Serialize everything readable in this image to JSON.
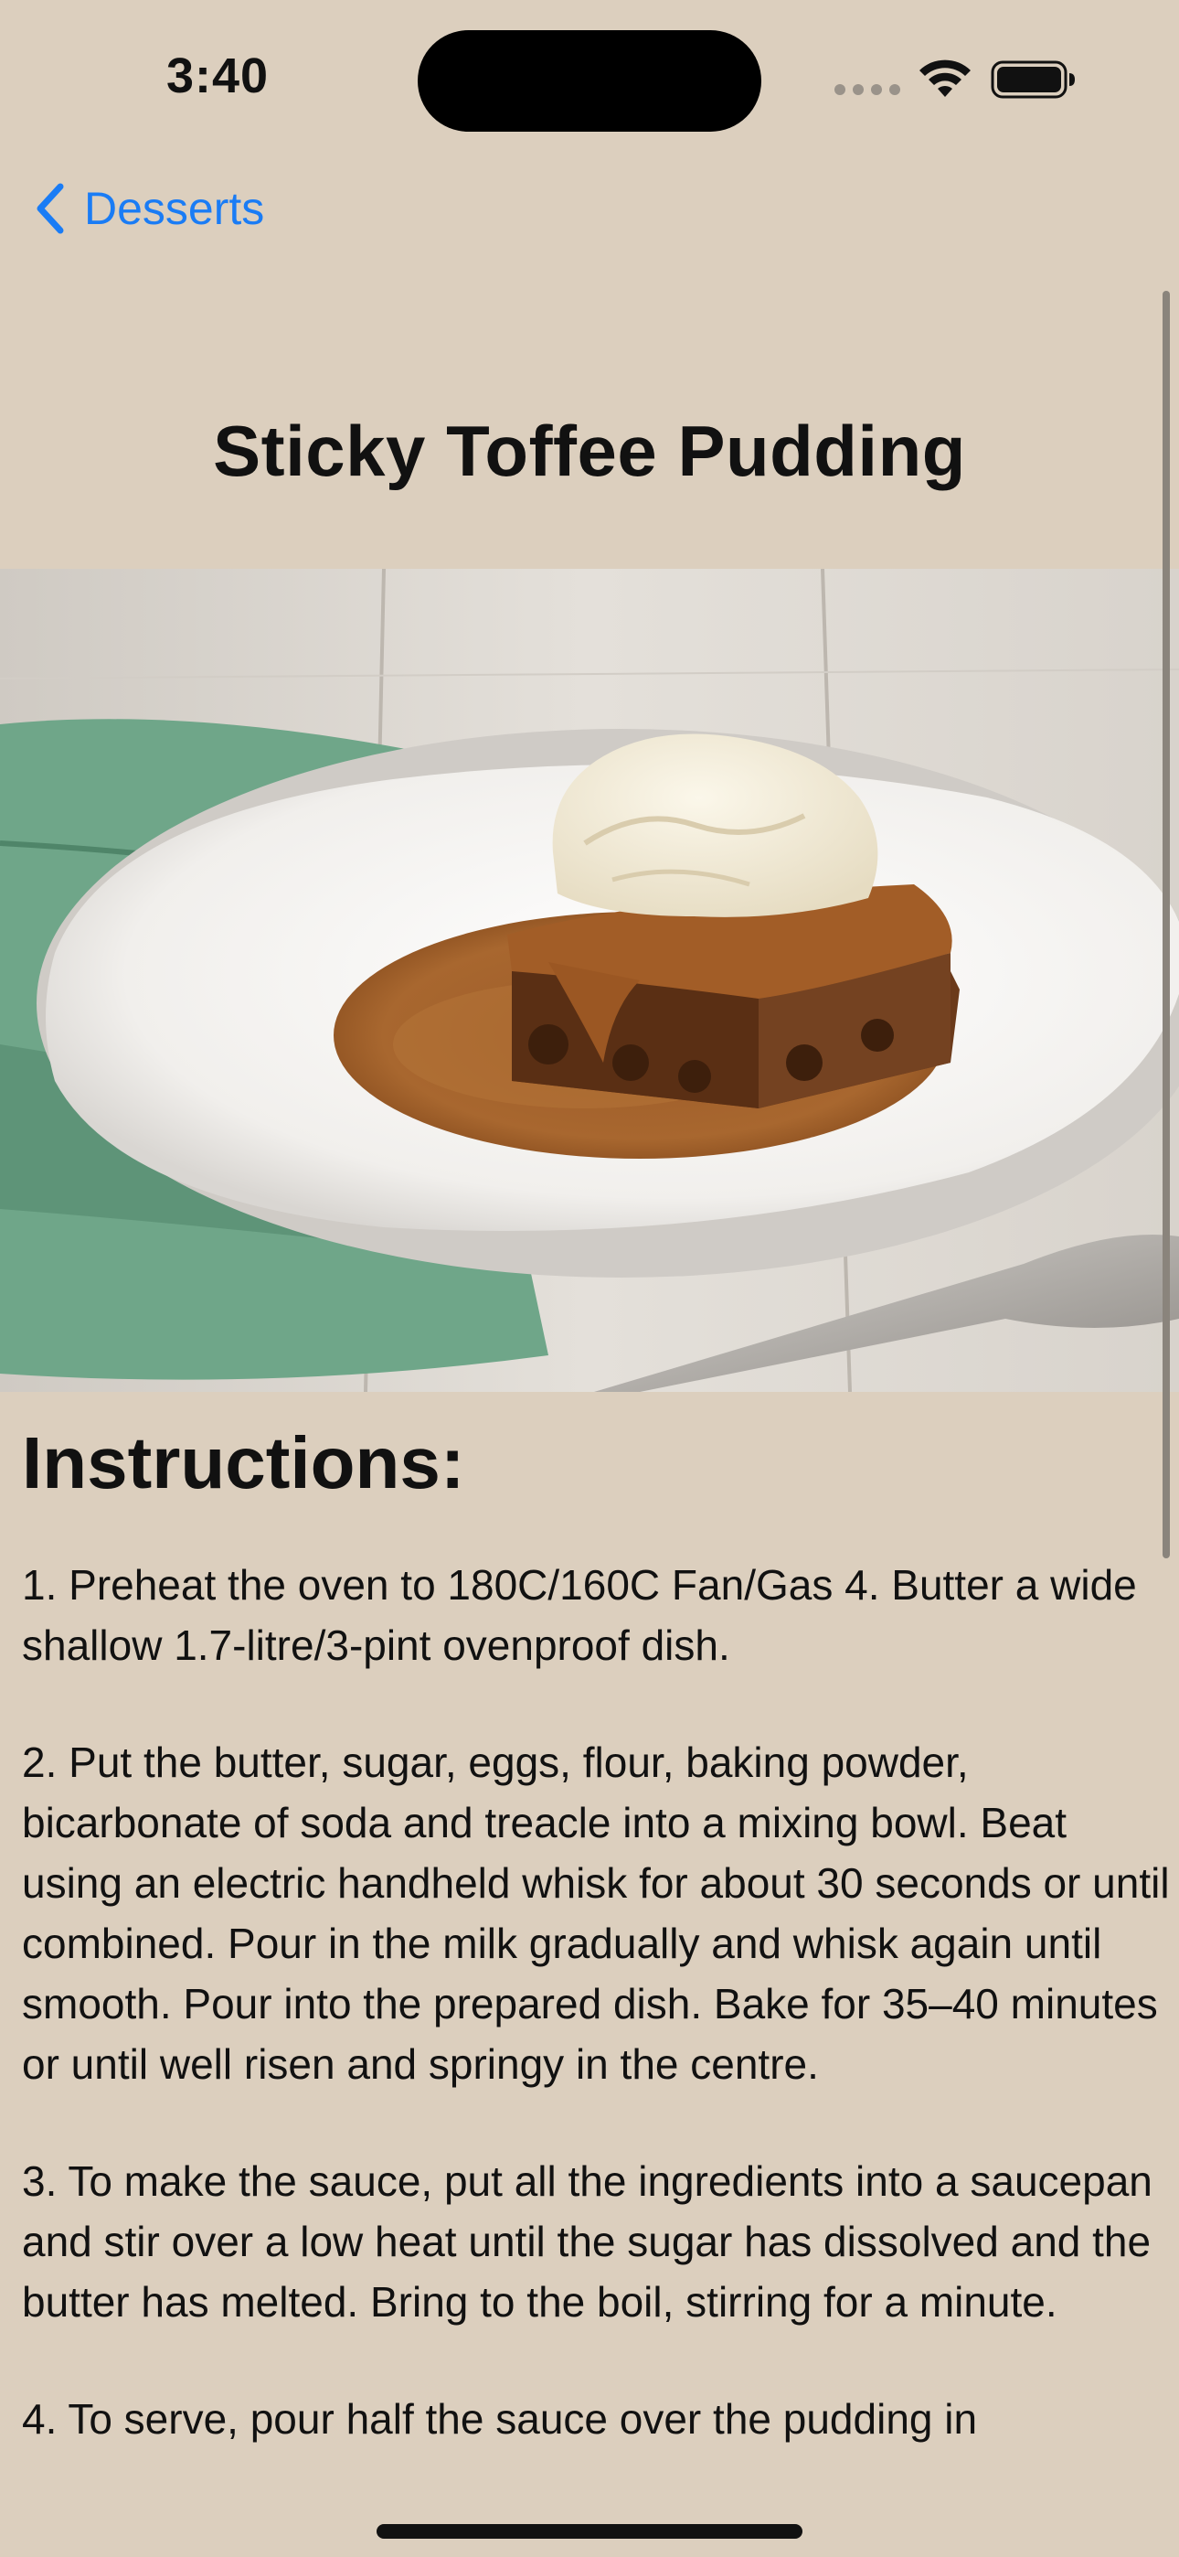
{
  "status_bar": {
    "time": "3:40"
  },
  "nav": {
    "back_label": "Desserts"
  },
  "meal": {
    "title": "Sticky Toffee Pudding"
  },
  "instructions": {
    "heading": "Instructions:",
    "steps": [
      "1. Preheat the oven to 180C/160C Fan/Gas 4. Butter a wide shallow 1.7-litre/3-pint ovenproof dish.",
      "2. Put the butter, sugar, eggs, flour, baking powder, bicarbonate of soda and treacle into a mixing bowl. Beat using an electric handheld whisk for about 30 seconds or until combined. Pour in the milk gradually and whisk again until smooth. Pour into the prepared dish. Bake for 35–40 minutes or until well risen and springy in the centre.",
      "3. To make the sauce, put all the ingredients into a saucepan and stir over a low heat until the sugar has dissolved and the butter has melted. Bring to the boil, stirring for a minute.",
      "4. To serve, pour half the sauce over the pudding in"
    ]
  },
  "icons": {
    "back": "chevron-left-icon",
    "wifi": "wifi-icon",
    "battery": "battery-icon"
  },
  "colors": {
    "background": "#dccfbe",
    "accent": "#1a7cf5"
  }
}
